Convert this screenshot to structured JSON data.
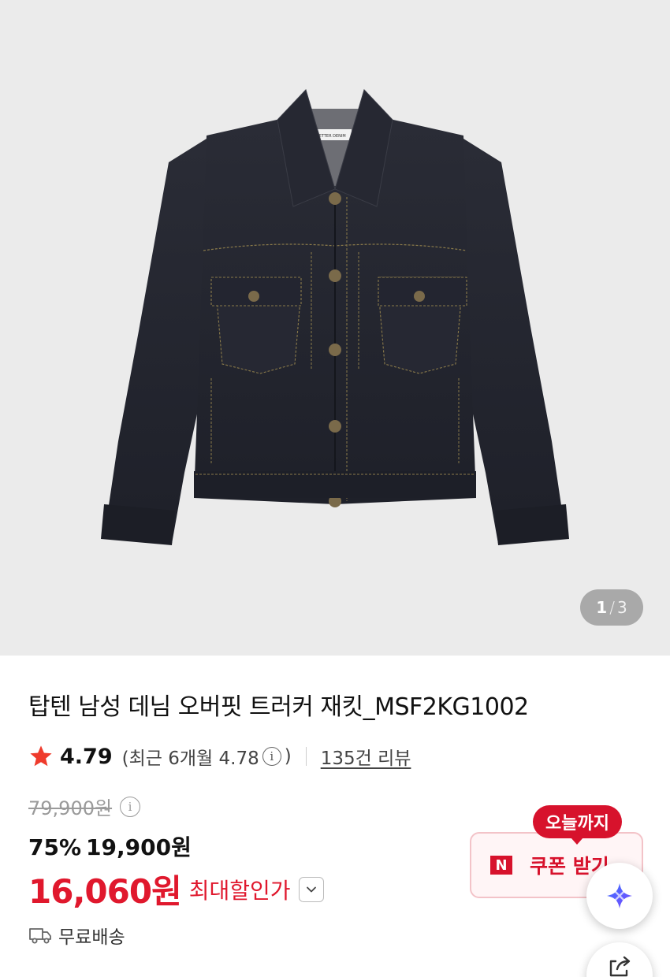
{
  "gallery": {
    "current": "1",
    "separator": "/",
    "total": "3",
    "image_icon": "denim-jacket-product-photo",
    "label_text": "BETTER DENIM"
  },
  "product": {
    "title": "탑텐 남성 데님 오버핏 트러커 재킷_MSF2KG1002"
  },
  "rating": {
    "star_icon": "star-icon",
    "score": "4.79",
    "recent_prefix": "(최근 6개월 4.78",
    "info_glyph": "i",
    "recent_suffix": ")",
    "reviews": "135건 리뷰"
  },
  "price": {
    "original": "79,900원",
    "discount": "75%",
    "sale": "19,900원",
    "final": "16,060원",
    "max_discount_label": "최대할인가"
  },
  "shipping": {
    "label": "무료배송"
  },
  "coupon": {
    "badge": "오늘까지",
    "logo": "N",
    "label": "쿠폰 받기"
  },
  "colors": {
    "accent_red": "#e0182d",
    "coupon_red": "#d7122c",
    "gallery_bg": "#ebebeb"
  }
}
